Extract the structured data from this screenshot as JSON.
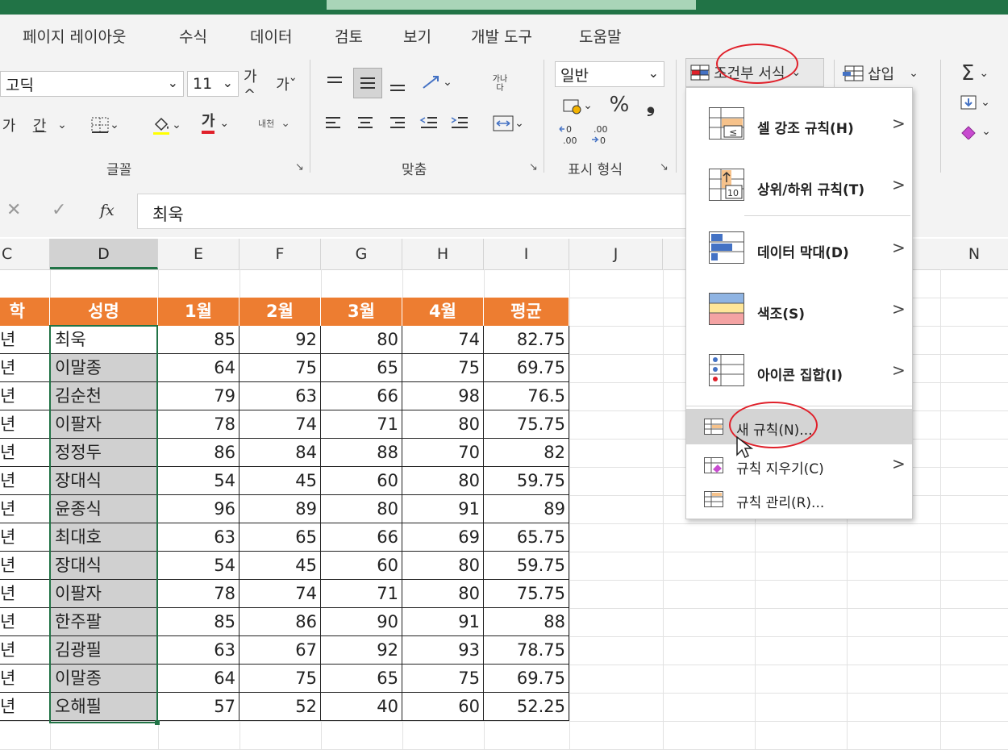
{
  "tabs": [
    "페이지 레이아웃",
    "수식",
    "데이터",
    "검토",
    "보기",
    "개발 도구",
    "도움말"
  ],
  "ribbon": {
    "font_name": "고딕",
    "font_size": "11",
    "grow_font": "가^",
    "shrink_font": "가ˇ",
    "italic": "가",
    "underline": "간",
    "font_color_glyph": "가",
    "phonetic": "내천",
    "wrap_text": "가나다",
    "number_format": "일반",
    "percent": "%",
    "comma": "❟",
    "inc_decimal": "←0 .00",
    "dec_decimal": ".00 →0",
    "conditional_format": "조건부 서식",
    "insert": "삽입",
    "groups": {
      "font": "글꼴",
      "alignment": "맞춤",
      "number": "표시 형식"
    }
  },
  "formula_bar": {
    "cancel": "✕",
    "enter": "✓",
    "fx": "fx",
    "value": "최욱"
  },
  "columns": [
    "C",
    "D",
    "E",
    "F",
    "G",
    "H",
    "I",
    "J",
    "N"
  ],
  "table": {
    "headers": [
      "학년",
      "성명",
      "1월",
      "2월",
      "3월",
      "4월",
      "평균"
    ],
    "rows": [
      [
        "년",
        "최욱",
        "85",
        "92",
        "80",
        "74",
        "82.75"
      ],
      [
        "년",
        "이말종",
        "64",
        "75",
        "65",
        "75",
        "69.75"
      ],
      [
        "년",
        "김순천",
        "79",
        "63",
        "66",
        "98",
        "76.5"
      ],
      [
        "년",
        "이팔자",
        "78",
        "74",
        "71",
        "80",
        "75.75"
      ],
      [
        "년",
        "정정두",
        "86",
        "84",
        "88",
        "70",
        "82"
      ],
      [
        "년",
        "장대식",
        "54",
        "45",
        "60",
        "80",
        "59.75"
      ],
      [
        "년",
        "윤종식",
        "96",
        "89",
        "80",
        "91",
        "89"
      ],
      [
        "년",
        "최대호",
        "63",
        "65",
        "66",
        "69",
        "65.75"
      ],
      [
        "년",
        "장대식",
        "54",
        "45",
        "60",
        "80",
        "59.75"
      ],
      [
        "년",
        "이팔자",
        "78",
        "74",
        "71",
        "80",
        "75.75"
      ],
      [
        "년",
        "한주팔",
        "85",
        "86",
        "90",
        "91",
        "88"
      ],
      [
        "년",
        "김광필",
        "63",
        "67",
        "92",
        "93",
        "78.75"
      ],
      [
        "년",
        "이말종",
        "64",
        "75",
        "65",
        "75",
        "69.75"
      ],
      [
        "년",
        "오해필",
        "57",
        "52",
        "40",
        "60",
        "52.25"
      ]
    ]
  },
  "menu": {
    "items": [
      {
        "label": "셀 강조 규칙(H)",
        "icon": "highlight-cells-icon"
      },
      {
        "label": "상위/하위 규칙(T)",
        "icon": "top-bottom-icon"
      },
      {
        "label": "데이터 막대(D)",
        "icon": "data-bars-icon"
      },
      {
        "label": "색조(S)",
        "icon": "color-scales-icon"
      },
      {
        "label": "아이콘 집합(I)",
        "icon": "icon-sets-icon"
      }
    ],
    "new_rule": "새 규칙(N)...",
    "clear_rules": "규칙 지우기(C)",
    "manage_rules": "규칙 관리(R)...",
    "chevron": ">"
  },
  "colors": {
    "header_orange": "#ed7d31",
    "excel_green": "#217346",
    "annotation_red": "#e0202a"
  }
}
